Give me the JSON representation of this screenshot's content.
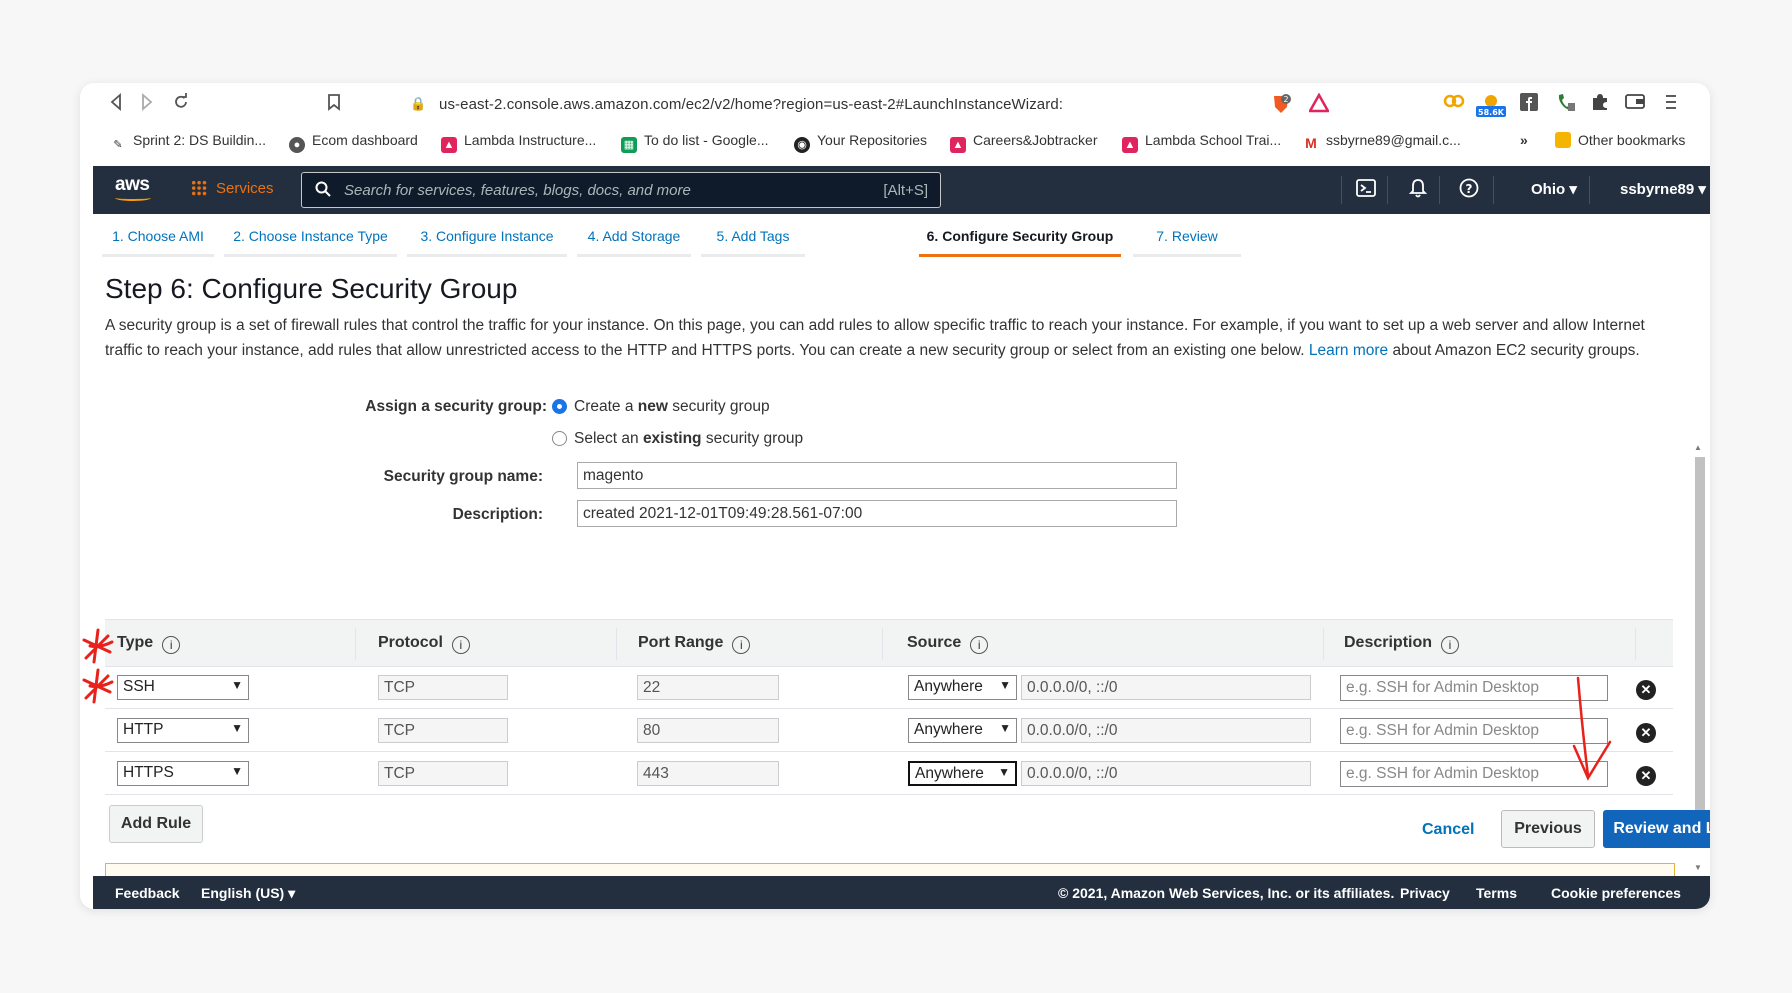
{
  "browser": {
    "url": "us-east-2.console.aws.amazon.com/ec2/v2/home?region=us-east-2#LaunchInstanceWizard:",
    "extension_badge": "58.6K",
    "shield_count": "2"
  },
  "bookmarks": [
    {
      "label": "Sprint 2: DS Buildin...",
      "icon": "pen-icon"
    },
    {
      "label": "Ecom dashboard",
      "icon": "globe-icon"
    },
    {
      "label": "Lambda Instructure...",
      "icon": "shield-icon"
    },
    {
      "label": "To do list - Google...",
      "icon": "sheets-icon"
    },
    {
      "label": "Your Repositories",
      "icon": "github-icon"
    },
    {
      "label": "Careers&Jobtracker",
      "icon": "shield-icon"
    },
    {
      "label": "Lambda School Trai...",
      "icon": "shield-icon"
    },
    {
      "label": "ssbyrne89@gmail.c...",
      "icon": "gmail-icon"
    },
    {
      "label": "Other bookmarks",
      "icon": "folder-icon"
    }
  ],
  "aws": {
    "logo": "aws",
    "services": "Services",
    "search_placeholder": "Search for services, features, blogs, docs, and more",
    "search_shortcut": "[Alt+S]",
    "region": "Ohio ▾",
    "user": "ssbyrne89 ▾"
  },
  "wizard_tabs": [
    {
      "label": "1. Choose AMI",
      "active": false
    },
    {
      "label": "2. Choose Instance Type",
      "active": false
    },
    {
      "label": "3. Configure Instance",
      "active": false
    },
    {
      "label": "4. Add Storage",
      "active": false
    },
    {
      "label": "5. Add Tags",
      "active": false
    },
    {
      "label": "6. Configure Security Group",
      "active": true
    },
    {
      "label": "7. Review",
      "active": false
    }
  ],
  "page": {
    "title": "Step 6: Configure Security Group",
    "intro_1": "A security group is a set of firewall rules that control the traffic for your instance. On this page, you can add rules to allow specific traffic to reach your instance. For example, if you want to set up a web server and allow Internet traffic to reach your instance, add rules that allow unrestricted access to the HTTP and HTTPS ports. You can create a new security group or select from an existing one below.",
    "learn_more": "Learn more",
    "intro_2": "about Amazon EC2 security groups.",
    "assign_label": "Assign a security group:",
    "radio_new_pre": "Create a ",
    "radio_new_bold": "new",
    "radio_new_post": " security group",
    "radio_existing_pre": "Select an ",
    "radio_existing_bold": "existing",
    "radio_existing_post": " security group",
    "sg_name_label": "Security group name:",
    "sg_name_value": "magento",
    "desc_label": "Description:",
    "desc_value": "created 2021-12-01T09:49:28.561-07:00"
  },
  "table": {
    "headers": [
      "Type",
      "Protocol",
      "Port Range",
      "Source",
      "Description"
    ],
    "rows": [
      {
        "type": "SSH",
        "protocol": "TCP",
        "port": "22",
        "source": "Anywhere",
        "cidr": "0.0.0.0/0, ::/0",
        "desc_placeholder": "e.g. SSH for Admin Desktop"
      },
      {
        "type": "HTTP",
        "protocol": "TCP",
        "port": "80",
        "source": "Anywhere",
        "cidr": "0.0.0.0/0, ::/0",
        "desc_placeholder": "e.g. SSH for Admin Desktop"
      },
      {
        "type": "HTTPS",
        "protocol": "TCP",
        "port": "443",
        "source": "Anywhere",
        "cidr": "0.0.0.0/0, ::/0",
        "desc_placeholder": "e.g. SSH for Admin Desktop"
      }
    ],
    "add_rule": "Add Rule"
  },
  "actions": {
    "cancel": "Cancel",
    "previous": "Previous",
    "review": "Review and Launch"
  },
  "footer": {
    "feedback": "Feedback",
    "language": "English (US) ▾",
    "copyright": "© 2021, Amazon Web Services, Inc. or its affiliates.",
    "privacy": "Privacy",
    "terms": "Terms",
    "cookies": "Cookie preferences"
  },
  "colors": {
    "aws_nav": "#232f3e",
    "aws_orange": "#ec7211",
    "link_blue": "#0073bb",
    "primary_button": "#1166bb",
    "annotation_red": "#e8211a"
  }
}
